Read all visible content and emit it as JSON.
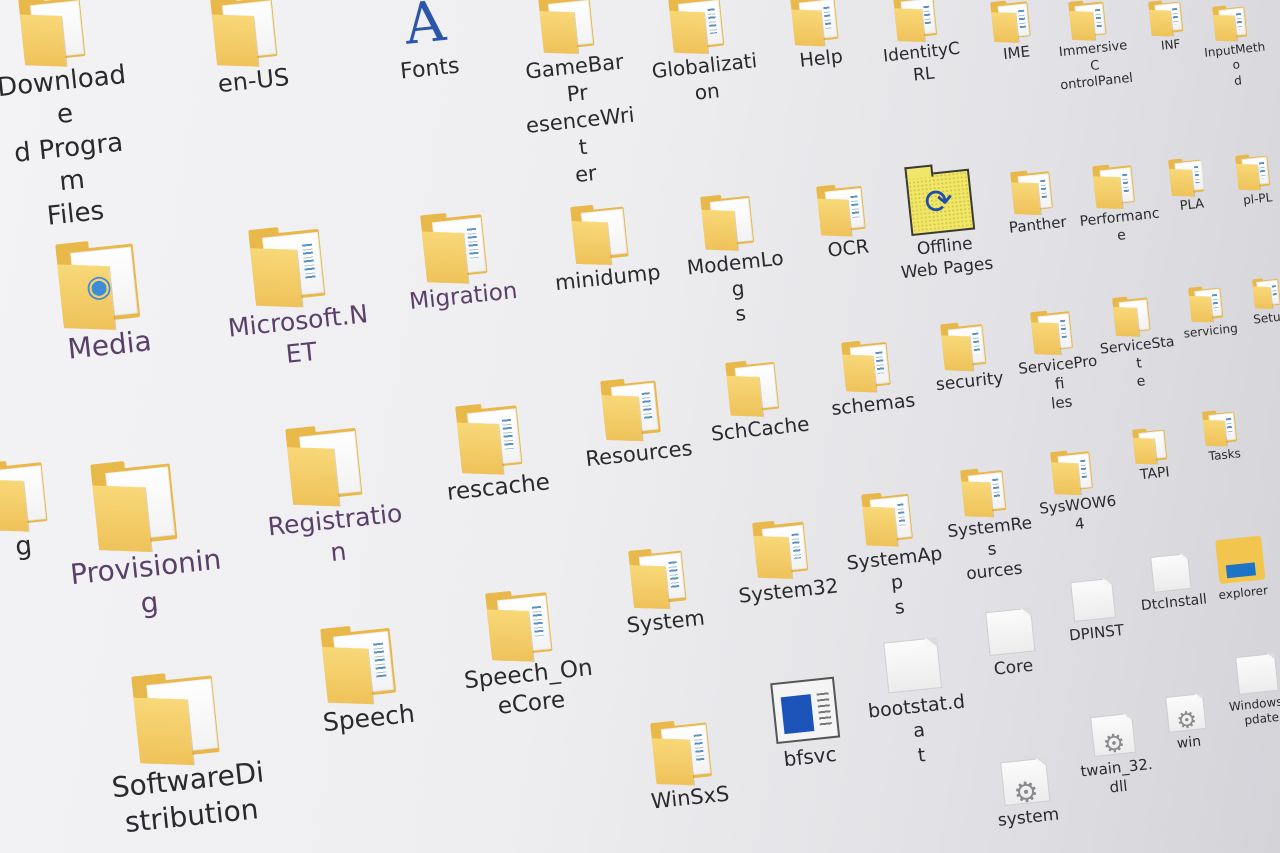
{
  "items": [
    {
      "label": "Downloade\nd Program\nFiles",
      "icon": "folder-icon"
    },
    {
      "label": "en-US",
      "icon": "folder-icon"
    },
    {
      "label": "Fonts",
      "icon": "font-icon"
    },
    {
      "label": "GameBarPr\nesenceWrit\ner",
      "icon": "folder-icon"
    },
    {
      "label": "Globalizati\non",
      "icon": "folder-icon"
    },
    {
      "label": "Help",
      "icon": "folder-icon"
    },
    {
      "label": "IdentityCRL",
      "icon": "folder-icon"
    },
    {
      "label": "IME",
      "icon": "folder-icon"
    },
    {
      "label": "ImmersiveC\nontrolPanel",
      "icon": "folder-icon"
    },
    {
      "label": "INF",
      "icon": "folder-icon"
    },
    {
      "label": "InputMetho\nd",
      "icon": "folder-icon"
    },
    {
      "label": "Media",
      "icon": "folder-icon"
    },
    {
      "label": "Microsoft.N\nET",
      "icon": "folder-icon"
    },
    {
      "label": "Migration",
      "icon": "folder-icon"
    },
    {
      "label": "minidump",
      "icon": "folder-icon"
    },
    {
      "label": "ModemLog\ns",
      "icon": "folder-icon"
    },
    {
      "label": "OCR",
      "icon": "folder-icon"
    },
    {
      "label": "Offline\nWeb Pages",
      "icon": "offline-web-pages-icon"
    },
    {
      "label": "Panther",
      "icon": "folder-icon"
    },
    {
      "label": "Performanc\ne",
      "icon": "folder-icon"
    },
    {
      "label": "PLA",
      "icon": "folder-icon"
    },
    {
      "label": "pl-PL",
      "icon": "folder-icon"
    },
    {
      "label": "Registratio\nn",
      "icon": "folder-icon"
    },
    {
      "label": "rescache",
      "icon": "folder-icon"
    },
    {
      "label": "Resources",
      "icon": "folder-icon"
    },
    {
      "label": "SchCache",
      "icon": "folder-icon"
    },
    {
      "label": "schemas",
      "icon": "folder-icon"
    },
    {
      "label": "security",
      "icon": "folder-icon"
    },
    {
      "label": "ServiceProfi\nles",
      "icon": "folder-icon"
    },
    {
      "label": "ServiceStat\ne",
      "icon": "folder-icon"
    },
    {
      "label": "servicing",
      "icon": "folder-icon"
    },
    {
      "label": "Setup",
      "icon": "folder-icon"
    },
    {
      "label": "g",
      "icon": "folder-icon"
    },
    {
      "label": "Provisionin\ng",
      "icon": "folder-icon"
    },
    {
      "label": "System",
      "icon": "folder-icon"
    },
    {
      "label": "System32",
      "icon": "folder-icon"
    },
    {
      "label": "SystemApp\ns",
      "icon": "folder-icon"
    },
    {
      "label": "SystemRes\nources",
      "icon": "folder-icon"
    },
    {
      "label": "SysWOW64",
      "icon": "folder-icon"
    },
    {
      "label": "TAPI",
      "icon": "folder-icon"
    },
    {
      "label": "Tasks",
      "icon": "folder-icon"
    },
    {
      "label": "Speech",
      "icon": "folder-icon"
    },
    {
      "label": "Speech_On\neCore",
      "icon": "folder-icon"
    },
    {
      "label": "bootstat.da\nt",
      "icon": "file-icon"
    },
    {
      "label": "Core",
      "icon": "file-icon"
    },
    {
      "label": "DPINST",
      "icon": "file-icon"
    },
    {
      "label": "DtcInstall",
      "icon": "file-icon"
    },
    {
      "label": "explorer",
      "icon": "explorer-icon"
    },
    {
      "label": "SoftwareDi\nstribution",
      "icon": "folder-icon"
    },
    {
      "label": "WinSxS",
      "icon": "folder-icon"
    },
    {
      "label": "bfsvc",
      "icon": "bfsvc-icon"
    },
    {
      "label": "system",
      "icon": "gear-file-icon"
    },
    {
      "label": "twain_32.dll",
      "icon": "gear-file-icon"
    },
    {
      "label": "win",
      "icon": "gear-file-icon"
    },
    {
      "label": "WindowsU\npdate",
      "icon": "file-icon"
    }
  ]
}
